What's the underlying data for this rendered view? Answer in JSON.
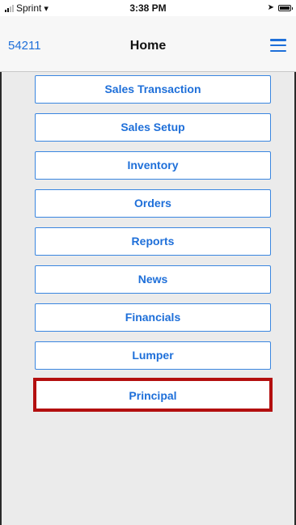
{
  "status_bar": {
    "carrier": "Sprint",
    "time": "3:38 PM"
  },
  "nav": {
    "left_text": "54211",
    "title": "Home",
    "menu_icon": "hamburger-menu-icon"
  },
  "menu": {
    "items": [
      {
        "label": "Sales Transaction"
      },
      {
        "label": "Sales Setup"
      },
      {
        "label": "Inventory"
      },
      {
        "label": "Orders"
      },
      {
        "label": "Reports"
      },
      {
        "label": "News"
      },
      {
        "label": "Financials"
      },
      {
        "label": "Lumper"
      },
      {
        "label": "Principal"
      }
    ],
    "highlighted_item": "Principal",
    "accent_color": "#1e6fd9",
    "highlight_color": "#b30f0f"
  }
}
